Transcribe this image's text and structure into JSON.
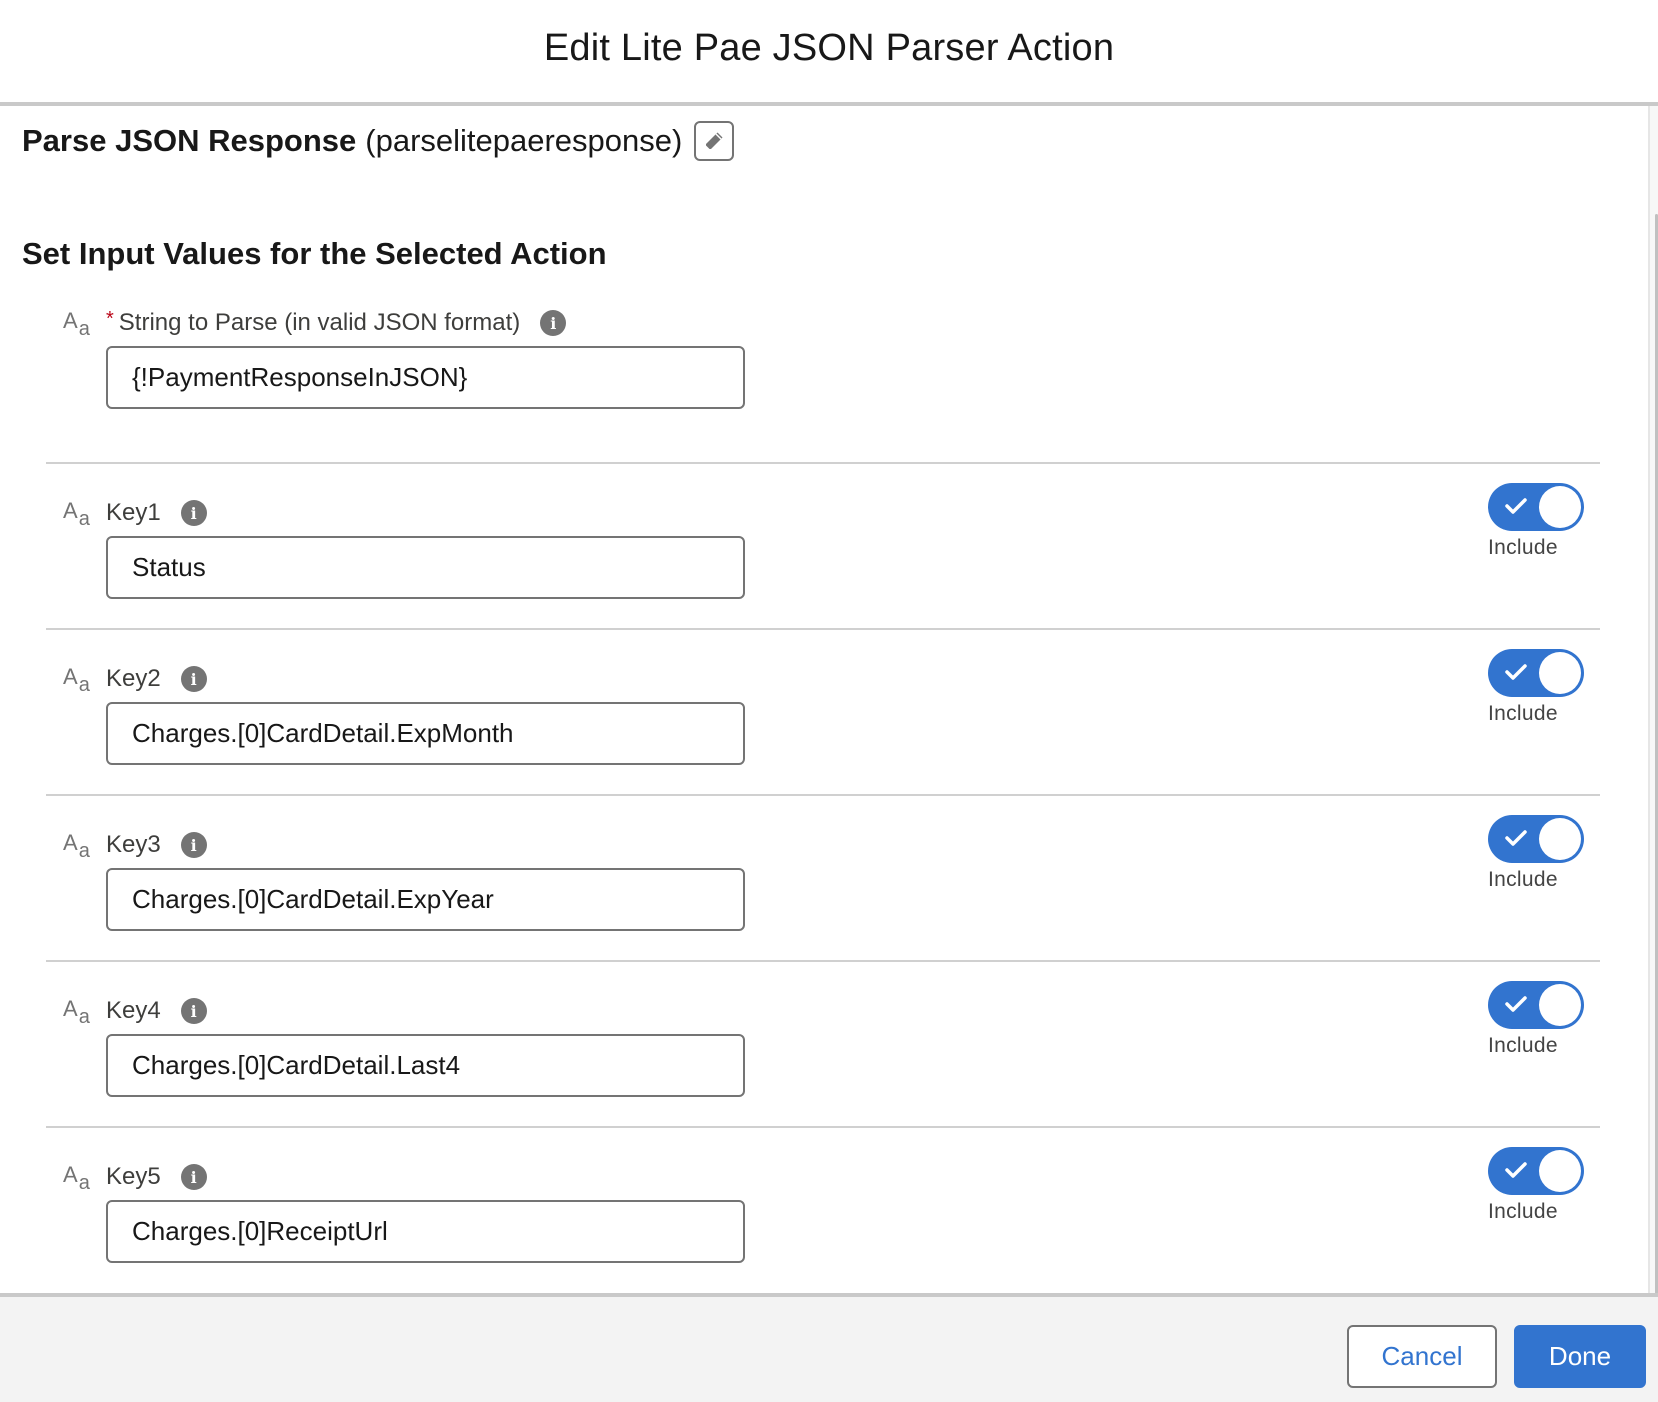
{
  "header": {
    "title": "Edit Lite Pae JSON Parser Action"
  },
  "action": {
    "name": "Parse JSON Response",
    "api_name": "(parselitepaeresponse)",
    "edit_icon": "pencil-icon"
  },
  "section": {
    "title": "Set Input Values for the Selected Action"
  },
  "fields": [
    {
      "type_icon": "text-type-icon",
      "required": true,
      "required_marker": "*",
      "label": "String to Parse (in valid JSON format)",
      "value": "{!PaymentResponseInJSON}",
      "has_toggle": false
    },
    {
      "type_icon": "text-type-icon",
      "required": false,
      "label": "Key1",
      "value": "Status",
      "has_toggle": true,
      "toggle_on": true,
      "toggle_label": "Include"
    },
    {
      "type_icon": "text-type-icon",
      "required": false,
      "label": "Key2",
      "value": "Charges.[0]CardDetail.ExpMonth",
      "has_toggle": true,
      "toggle_on": true,
      "toggle_label": "Include"
    },
    {
      "type_icon": "text-type-icon",
      "required": false,
      "label": "Key3",
      "value": "Charges.[0]CardDetail.ExpYear",
      "has_toggle": true,
      "toggle_on": true,
      "toggle_label": "Include"
    },
    {
      "type_icon": "text-type-icon",
      "required": false,
      "label": "Key4",
      "value": "Charges.[0]CardDetail.Last4",
      "has_toggle": true,
      "toggle_on": true,
      "toggle_label": "Include"
    },
    {
      "type_icon": "text-type-icon",
      "required": false,
      "label": "Key5",
      "value": "Charges.[0]ReceiptUrl",
      "has_toggle": true,
      "toggle_on": true,
      "toggle_label": "Include"
    }
  ],
  "footer": {
    "cancel_label": "Cancel",
    "done_label": "Done"
  },
  "colors": {
    "brand": "#3274cf",
    "required": "#ba0517",
    "border": "#747474",
    "footer_bg": "#f3f3f3"
  }
}
